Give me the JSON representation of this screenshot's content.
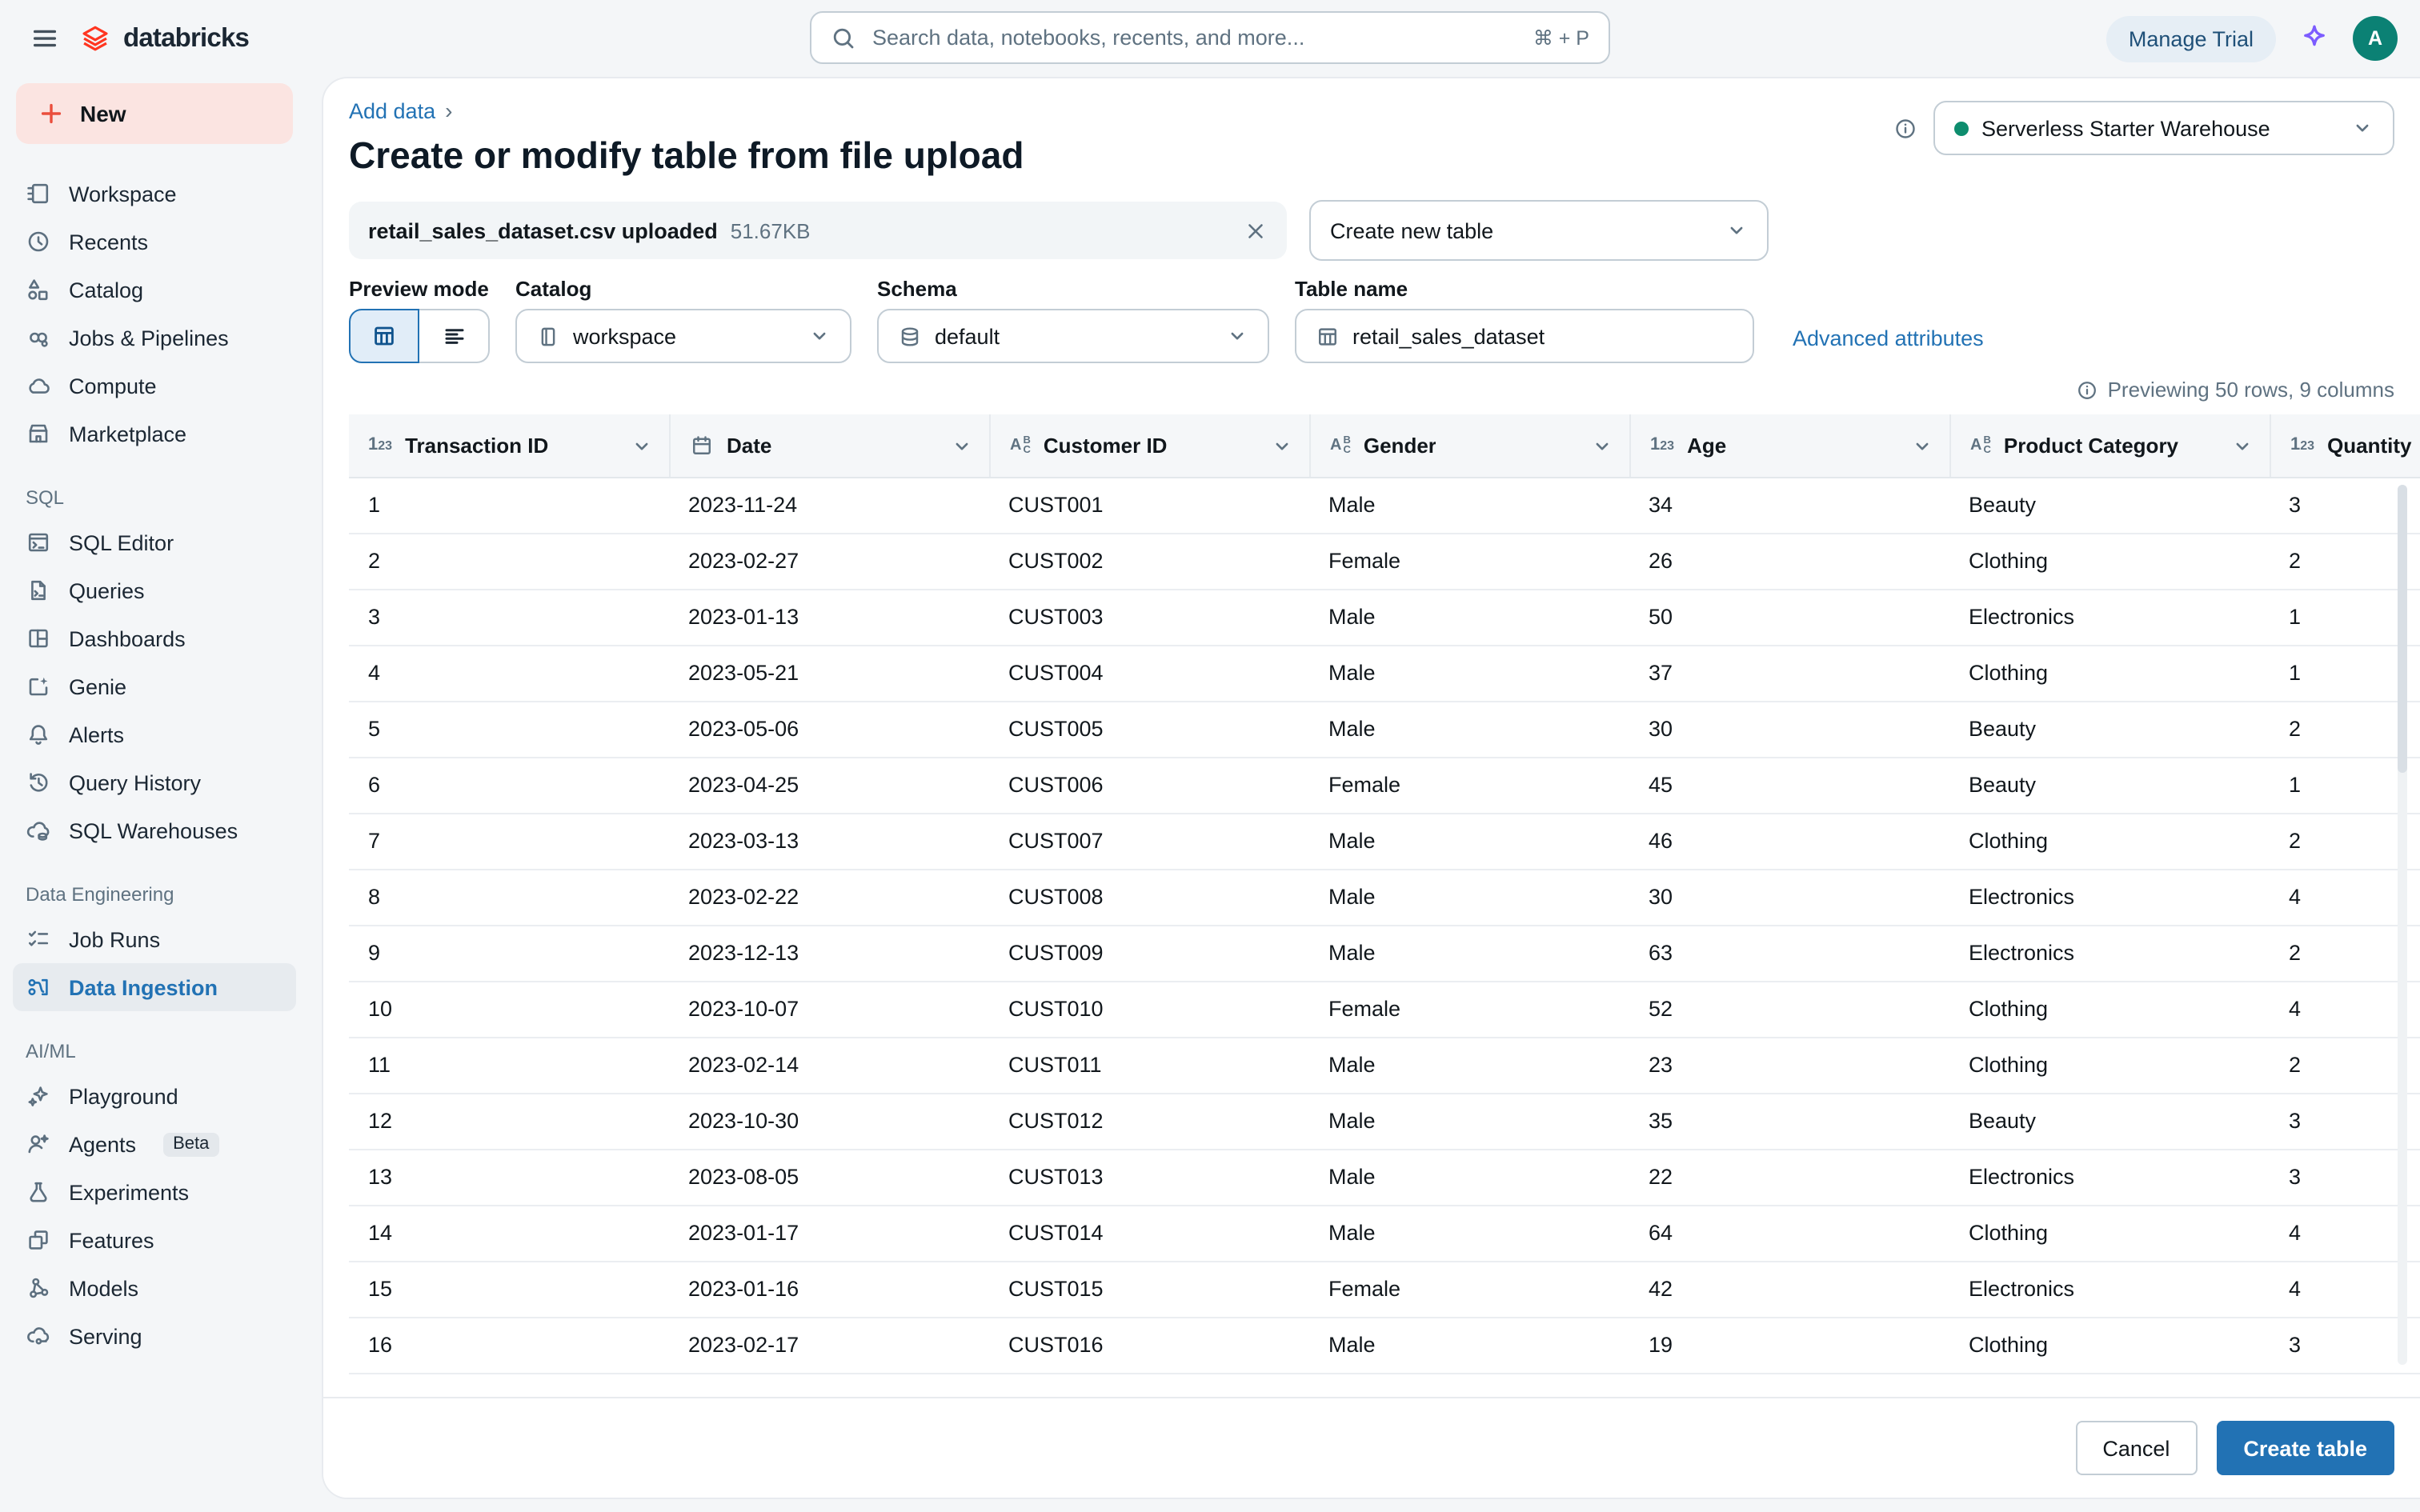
{
  "topbar": {
    "brand": "databricks",
    "search_placeholder": "Search data, notebooks, recents, and more...",
    "search_shortcut": "⌘ + P",
    "manage_trial_label": "Manage Trial",
    "avatar_initial": "A"
  },
  "sidebar": {
    "new_label": "New",
    "sections": [
      {
        "items": [
          {
            "label": "Workspace",
            "icon": "workspace"
          },
          {
            "label": "Recents",
            "icon": "recents"
          },
          {
            "label": "Catalog",
            "icon": "catalog"
          },
          {
            "label": "Jobs & Pipelines",
            "icon": "jobs-pipelines"
          },
          {
            "label": "Compute",
            "icon": "compute"
          },
          {
            "label": "Marketplace",
            "icon": "marketplace"
          }
        ]
      },
      {
        "header": "SQL",
        "items": [
          {
            "label": "SQL Editor",
            "icon": "sql-editor"
          },
          {
            "label": "Queries",
            "icon": "queries"
          },
          {
            "label": "Dashboards",
            "icon": "dashboards"
          },
          {
            "label": "Genie",
            "icon": "genie"
          },
          {
            "label": "Alerts",
            "icon": "alerts"
          },
          {
            "label": "Query History",
            "icon": "query-history"
          },
          {
            "label": "SQL Warehouses",
            "icon": "sql-warehouses"
          }
        ]
      },
      {
        "header": "Data Engineering",
        "items": [
          {
            "label": "Job Runs",
            "icon": "job-runs"
          },
          {
            "label": "Data Ingestion",
            "icon": "data-ingestion",
            "active": true
          }
        ]
      },
      {
        "header": "AI/ML",
        "items": [
          {
            "label": "Playground",
            "icon": "playground"
          },
          {
            "label": "Agents",
            "icon": "agents",
            "badge": "Beta"
          },
          {
            "label": "Experiments",
            "icon": "experiments"
          },
          {
            "label": "Features",
            "icon": "features"
          },
          {
            "label": "Models",
            "icon": "models"
          },
          {
            "label": "Serving",
            "icon": "serving"
          }
        ]
      }
    ]
  },
  "page": {
    "breadcrumb": "Add data",
    "breadcrumb_separator": "›",
    "title": "Create or modify table from file upload",
    "warehouse": {
      "value": "Serverless Starter Warehouse",
      "status_color": "#0E8D6E"
    },
    "upload": {
      "filename": "retail_sales_dataset.csv uploaded",
      "filesize": "51.67KB"
    },
    "table_mode_select": {
      "value": "Create new table"
    },
    "controls": {
      "preview_mode_label": "Preview mode",
      "catalog_label": "Catalog",
      "catalog_value": "workspace",
      "schema_label": "Schema",
      "schema_value": "default",
      "table_name_label": "Table name",
      "table_name_value": "retail_sales_dataset"
    },
    "advanced_attributes_label": "Advanced attributes",
    "preview_summary": "Previewing 50 rows, 9 columns",
    "actions": {
      "cancel_label": "Cancel",
      "create_label": "Create table"
    }
  },
  "preview_table": {
    "columns": [
      {
        "label": "Transaction ID",
        "type": "number"
      },
      {
        "label": "Date",
        "type": "date"
      },
      {
        "label": "Customer ID",
        "type": "text"
      },
      {
        "label": "Gender",
        "type": "text"
      },
      {
        "label": "Age",
        "type": "number"
      },
      {
        "label": "Product Category",
        "type": "text"
      },
      {
        "label": "Quantity",
        "type": "number"
      }
    ],
    "rows": [
      [
        "1",
        "2023-11-24",
        "CUST001",
        "Male",
        "34",
        "Beauty",
        "3"
      ],
      [
        "2",
        "2023-02-27",
        "CUST002",
        "Female",
        "26",
        "Clothing",
        "2"
      ],
      [
        "3",
        "2023-01-13",
        "CUST003",
        "Male",
        "50",
        "Electronics",
        "1"
      ],
      [
        "4",
        "2023-05-21",
        "CUST004",
        "Male",
        "37",
        "Clothing",
        "1"
      ],
      [
        "5",
        "2023-05-06",
        "CUST005",
        "Male",
        "30",
        "Beauty",
        "2"
      ],
      [
        "6",
        "2023-04-25",
        "CUST006",
        "Female",
        "45",
        "Beauty",
        "1"
      ],
      [
        "7",
        "2023-03-13",
        "CUST007",
        "Male",
        "46",
        "Clothing",
        "2"
      ],
      [
        "8",
        "2023-02-22",
        "CUST008",
        "Male",
        "30",
        "Electronics",
        "4"
      ],
      [
        "9",
        "2023-12-13",
        "CUST009",
        "Male",
        "63",
        "Electronics",
        "2"
      ],
      [
        "10",
        "2023-10-07",
        "CUST010",
        "Female",
        "52",
        "Clothing",
        "4"
      ],
      [
        "11",
        "2023-02-14",
        "CUST011",
        "Male",
        "23",
        "Clothing",
        "2"
      ],
      [
        "12",
        "2023-10-30",
        "CUST012",
        "Male",
        "35",
        "Beauty",
        "3"
      ],
      [
        "13",
        "2023-08-05",
        "CUST013",
        "Male",
        "22",
        "Electronics",
        "3"
      ],
      [
        "14",
        "2023-01-17",
        "CUST014",
        "Male",
        "64",
        "Clothing",
        "4"
      ],
      [
        "15",
        "2023-01-16",
        "CUST015",
        "Female",
        "42",
        "Electronics",
        "4"
      ],
      [
        "16",
        "2023-02-17",
        "CUST016",
        "Male",
        "19",
        "Clothing",
        "3"
      ]
    ]
  },
  "colors": {
    "accent_blue": "#2272B4",
    "brand_red": "#FF3621",
    "avatar_teal": "#0B8174",
    "status_green": "#0E8D6E",
    "page_bg": "#F4F6F8"
  }
}
